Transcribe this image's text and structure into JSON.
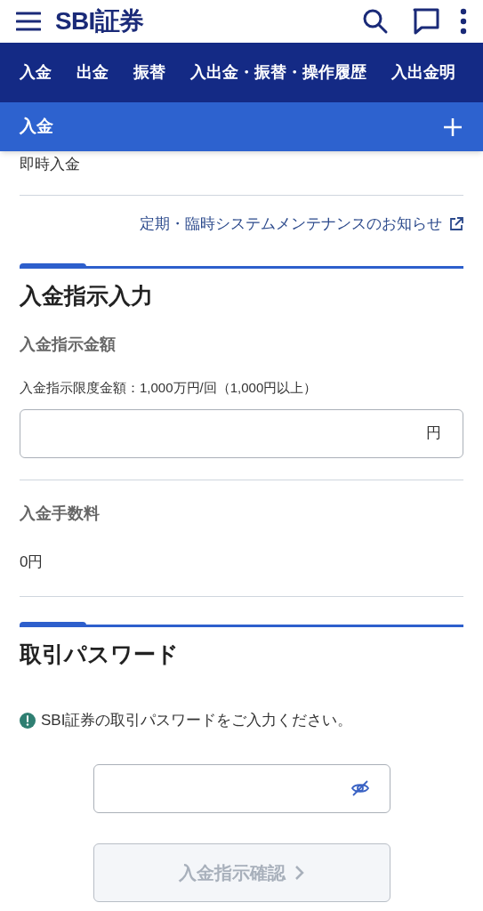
{
  "header": {
    "logo": "SBI証券"
  },
  "nav_tabs": [
    {
      "label": "入金"
    },
    {
      "label": "出金"
    },
    {
      "label": "振替"
    },
    {
      "label": "入出金・振替・操作履歴"
    },
    {
      "label": "入出金明"
    }
  ],
  "section_header": {
    "title": "入金",
    "expanded": false
  },
  "menu_item": "即時入金",
  "maintenance_link": "定期・臨時システムメンテナンスのお知らせ",
  "deposit_section": {
    "title": "入金指示入力",
    "amount_label": "入金指示金額",
    "limit_note": "入金指示限度金額：1,000万円/回（1,000円以上）",
    "unit": "円",
    "fee_label": "入金手数料",
    "fee_value": "0円"
  },
  "password_section": {
    "title": "取引パスワード",
    "message": "SBI証券の取引パスワードをご入力ください。"
  },
  "confirm_button": {
    "label": "入金指示確認",
    "disabled": true
  }
}
